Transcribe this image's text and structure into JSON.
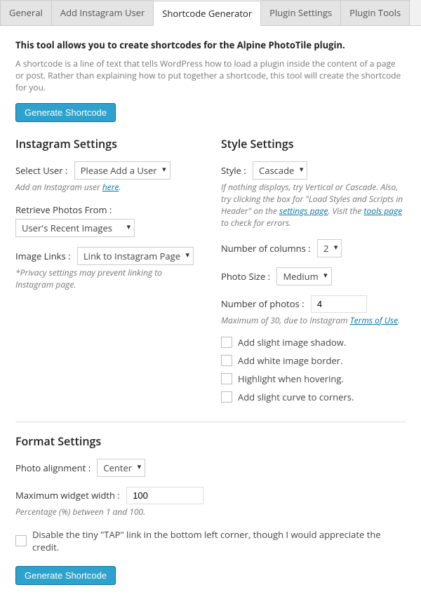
{
  "tabs": {
    "general": "General",
    "add_user": "Add Instagram User",
    "shortcode": "Shortcode Generator",
    "settings": "Plugin Settings",
    "tools": "Plugin Tools"
  },
  "intro": {
    "title": "This tool allows you to create shortcodes for the Alpine PhotoTile plugin.",
    "desc": "A shortcode is a line of text that tells WordPress how to load a plugin inside the content of a page or post. Rather than explaining how to put together a shortcode, this tool will create the shortcode for you."
  },
  "buttons": {
    "generate": "Generate Shortcode"
  },
  "instagram": {
    "heading": "Instagram Settings",
    "select_user_label": "Select User :",
    "select_user_value": "Please Add a User",
    "add_user_hint_prefix": "Add an Instagram user ",
    "add_user_link": "here",
    "retrieve_label": "Retrieve Photos From :",
    "retrieve_value": "User's Recent Images",
    "image_links_label": "Image Links :",
    "image_links_value": "Link to Instagram Page",
    "image_links_hint": "*Privacy settings may prevent linking to Instagram page."
  },
  "style": {
    "heading": "Style Settings",
    "style_label": "Style :",
    "style_value": "Cascade",
    "style_hint_1": "If nothing displays, try Vertical or Cascade. Also, try clicking the box for \"Load Styles and Scripts in Header\" on the ",
    "settings_link": "settings page",
    "style_hint_2": ". Visit the ",
    "tools_link": "tools page",
    "style_hint_3": " to check for errors.",
    "columns_label": "Number of columns :",
    "columns_value": "2",
    "photo_size_label": "Photo Size :",
    "photo_size_value": "Medium",
    "num_photos_label": "Number of photos :",
    "num_photos_value": "4",
    "num_photos_hint_prefix": "Maximum of 30, due to Instagram ",
    "terms_link": "Terms of Use",
    "cb_shadow": "Add slight image shadow.",
    "cb_border": "Add white image border.",
    "cb_highlight": "Highlight when hovering.",
    "cb_curve": "Add slight curve to corners."
  },
  "format": {
    "heading": "Format Settings",
    "alignment_label": "Photo alignment :",
    "alignment_value": "Center",
    "max_width_label": "Maximum widget width :",
    "max_width_value": "100",
    "max_width_hint": "Percentage (%) between 1 and 100.",
    "disable_tap": "Disable the tiny \"TAP\" link in the bottom left corner, though I would appreciate the credit."
  }
}
